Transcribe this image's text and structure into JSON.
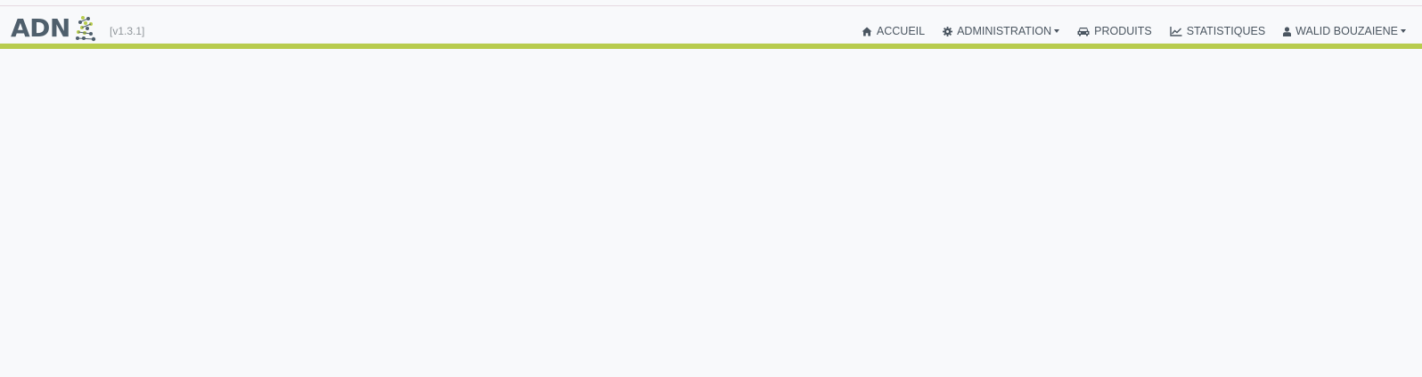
{
  "brand": {
    "name": "ADN",
    "version": "[v1.3.1]",
    "colors": {
      "text": "#4f5f6c",
      "accent": "#b8cc4e"
    }
  },
  "nav": {
    "items": [
      {
        "label": "ACCUEIL",
        "icon": "home-icon",
        "dropdown": false
      },
      {
        "label": "ADMINISTRATION",
        "icon": "gear-icon",
        "dropdown": true
      },
      {
        "label": "PRODUITS",
        "icon": "car-icon",
        "dropdown": false
      },
      {
        "label": "STATISTIQUES",
        "icon": "line-chart-icon",
        "dropdown": false
      },
      {
        "label": "WALID BOUZAIENE",
        "icon": "user-icon",
        "dropdown": true
      }
    ]
  }
}
